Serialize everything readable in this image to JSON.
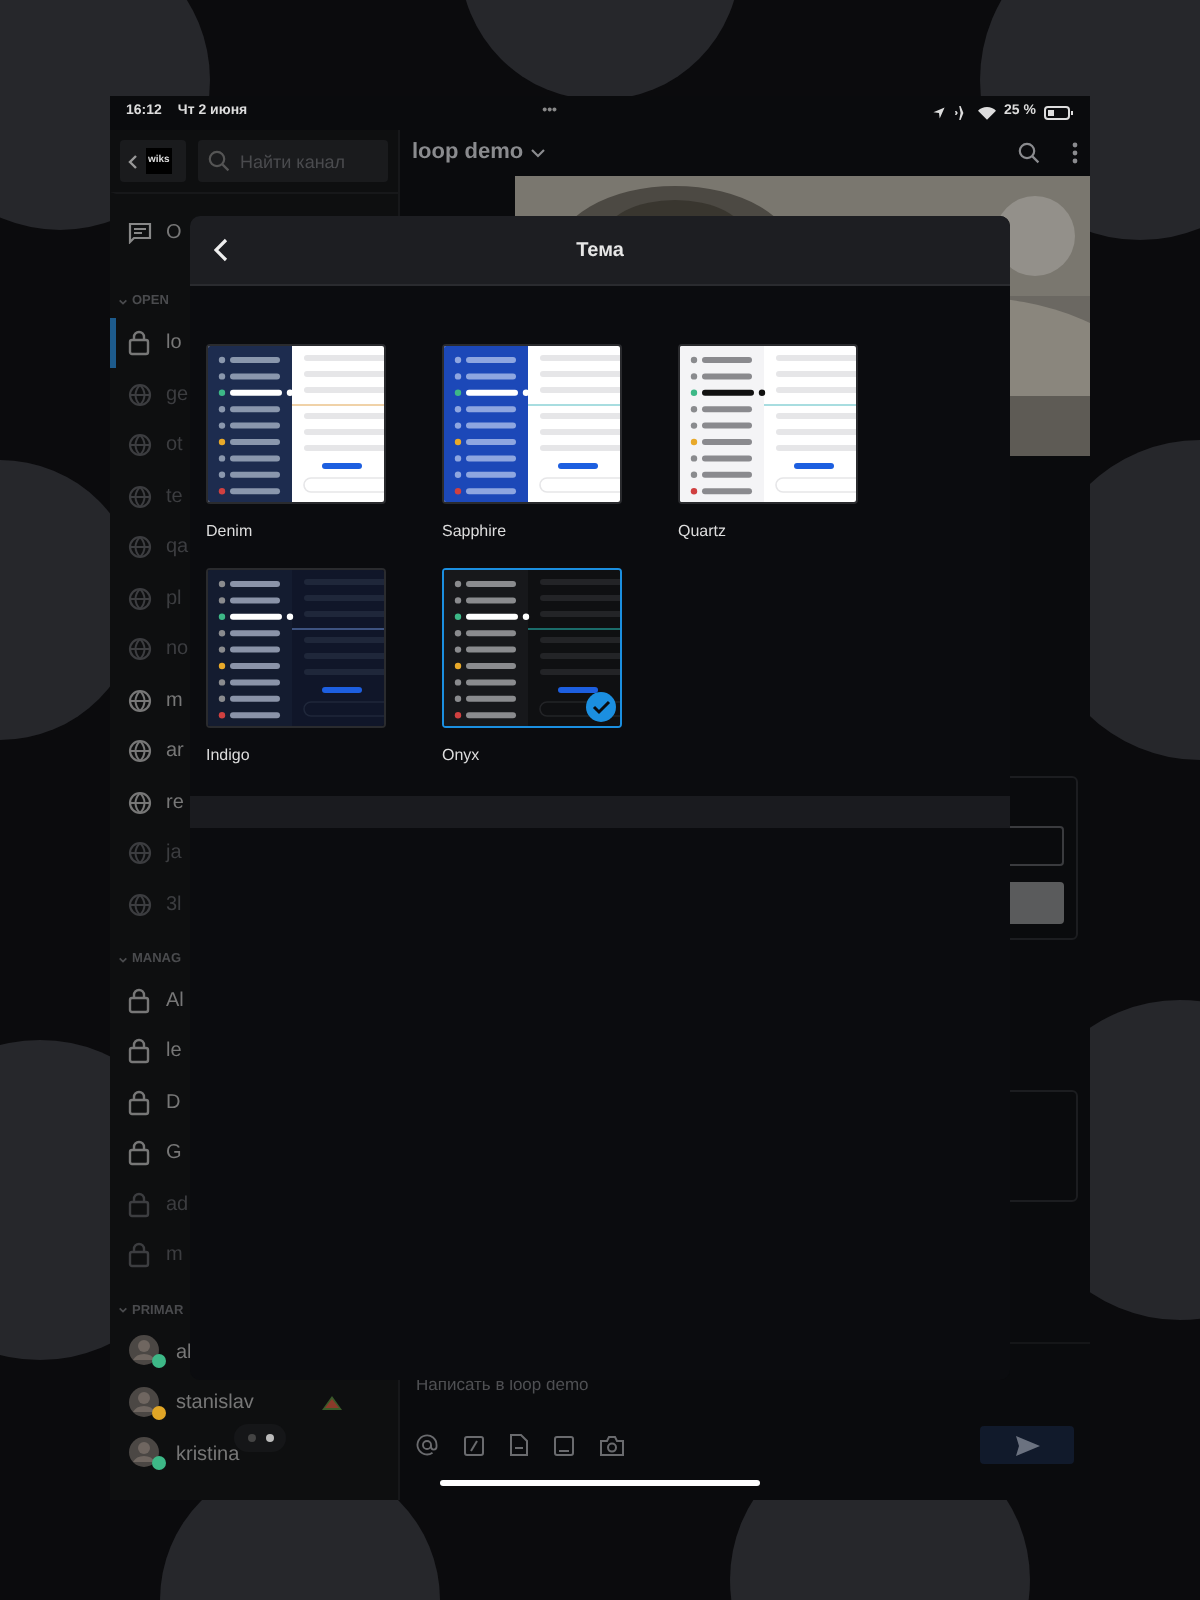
{
  "status_bar": {
    "time": "16:12",
    "date": "Чт 2 июня",
    "dots": "•••",
    "battery": "25 %"
  },
  "sidebar": {
    "logo": "wiks",
    "search_placeholder": "Найти канал",
    "top_item": {
      "label": "O"
    },
    "sections": [
      {
        "title": "OPEN",
        "items": [
          {
            "kind": "lock",
            "label": "lo",
            "muted": false,
            "selected": true
          },
          {
            "kind": "globe",
            "label": "ge",
            "muted": true,
            "selected": false
          },
          {
            "kind": "globe",
            "label": "ot",
            "muted": true,
            "selected": false
          },
          {
            "kind": "globe",
            "label": "te",
            "muted": true,
            "selected": false
          },
          {
            "kind": "globe",
            "label": "qa",
            "muted": true,
            "selected": false
          },
          {
            "kind": "globe",
            "label": "pl",
            "muted": true,
            "selected": false
          },
          {
            "kind": "globe",
            "label": "no",
            "muted": true,
            "selected": false
          },
          {
            "kind": "globe",
            "label": "m",
            "muted": false,
            "selected": false
          },
          {
            "kind": "globe",
            "label": "ar",
            "muted": false,
            "selected": false
          },
          {
            "kind": "globe",
            "label": "re",
            "muted": false,
            "selected": false
          },
          {
            "kind": "globe",
            "label": "ja",
            "muted": true,
            "selected": false
          },
          {
            "kind": "globe",
            "label": "3l",
            "muted": true,
            "selected": false
          }
        ]
      },
      {
        "title": "MANAG",
        "items": [
          {
            "kind": "lock",
            "label": "Al",
            "muted": false,
            "selected": false
          },
          {
            "kind": "lock",
            "label": "le",
            "muted": false,
            "selected": false
          },
          {
            "kind": "lock",
            "label": "D",
            "muted": false,
            "selected": false
          },
          {
            "kind": "lock",
            "label": "G",
            "muted": false,
            "selected": false
          },
          {
            "kind": "lock",
            "label": "ad",
            "muted": true,
            "selected": false
          },
          {
            "kind": "lock",
            "label": "m",
            "muted": true,
            "selected": false
          }
        ]
      },
      {
        "title": "PRIMAR",
        "items": [
          {
            "kind": "person",
            "label": "al",
            "color": "#3db887",
            "muted": false,
            "selected": false
          },
          {
            "kind": "person",
            "label": "stanislav",
            "color": "#e0a526",
            "muted": false,
            "selected": false
          },
          {
            "kind": "person",
            "label": "kristina",
            "color": "#3db887",
            "muted": false,
            "selected": false
          }
        ]
      }
    ]
  },
  "channel": {
    "title": "loop demo",
    "composer_placeholder": "Написать в loop demo"
  },
  "modal": {
    "title": "Тема",
    "themes": [
      {
        "kind": "denim",
        "label": "Denim",
        "selected": false
      },
      {
        "kind": "sapphire",
        "label": "Sapphire",
        "selected": false
      },
      {
        "kind": "quartz",
        "label": "Quartz",
        "selected": false
      },
      {
        "kind": "indigo",
        "label": "Indigo",
        "selected": false
      },
      {
        "kind": "onyx",
        "label": "Onyx",
        "selected": true
      }
    ]
  }
}
